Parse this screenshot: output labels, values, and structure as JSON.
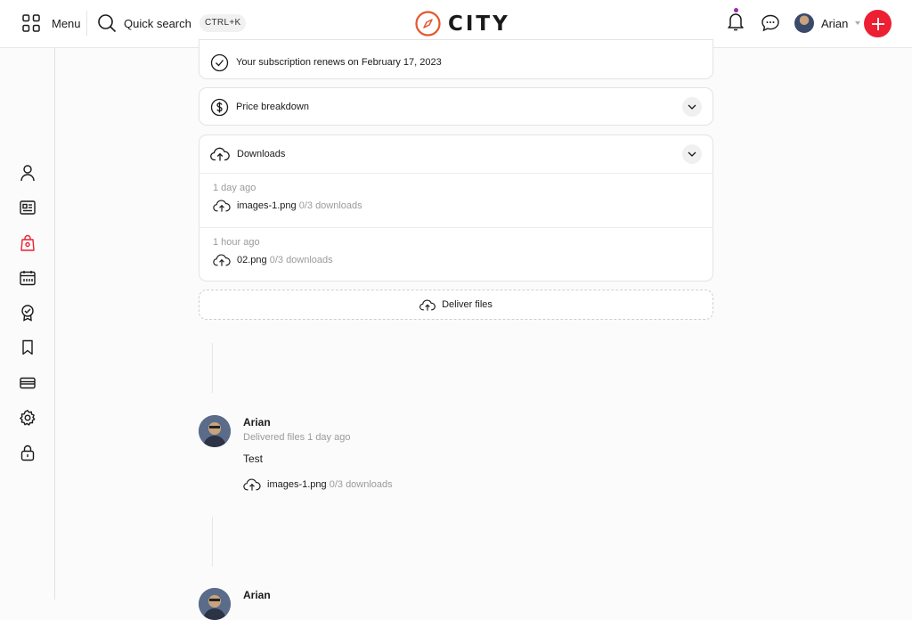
{
  "header": {
    "menu_label": "Menu",
    "search_label": "Quick search",
    "shortcut": "CTRL+K",
    "brand": "CITY",
    "user_name": "Arian",
    "accent_color": "#ec1f33",
    "notification_dot_color": "#9c27b0"
  },
  "sidebar": {
    "items": [
      {
        "icon": "user-icon"
      },
      {
        "icon": "id-card-icon"
      },
      {
        "icon": "shopping-bag-icon",
        "active": true
      },
      {
        "icon": "calendar-icon"
      },
      {
        "icon": "badge-check-icon"
      },
      {
        "icon": "bookmark-icon"
      },
      {
        "icon": "credit-card-icon"
      },
      {
        "icon": "settings-icon"
      },
      {
        "icon": "lock-icon"
      }
    ]
  },
  "subscription": {
    "text": "Your subscription renews on February 17, 2023"
  },
  "price": {
    "label": "Price breakdown"
  },
  "downloads": {
    "label": "Downloads",
    "entries": [
      {
        "time": "1 day ago",
        "file": "images-1.png",
        "count": "0/3 downloads"
      },
      {
        "time": "1 hour ago",
        "file": "02.png",
        "count": "0/3 downloads"
      }
    ]
  },
  "deliver": {
    "label": "Deliver files"
  },
  "timeline": [
    {
      "name": "Arian",
      "subtitle": "Delivered files 1 day ago",
      "text": "Test",
      "file": "images-1.png",
      "count": "0/3 downloads"
    },
    {
      "name": "Arian"
    }
  ]
}
